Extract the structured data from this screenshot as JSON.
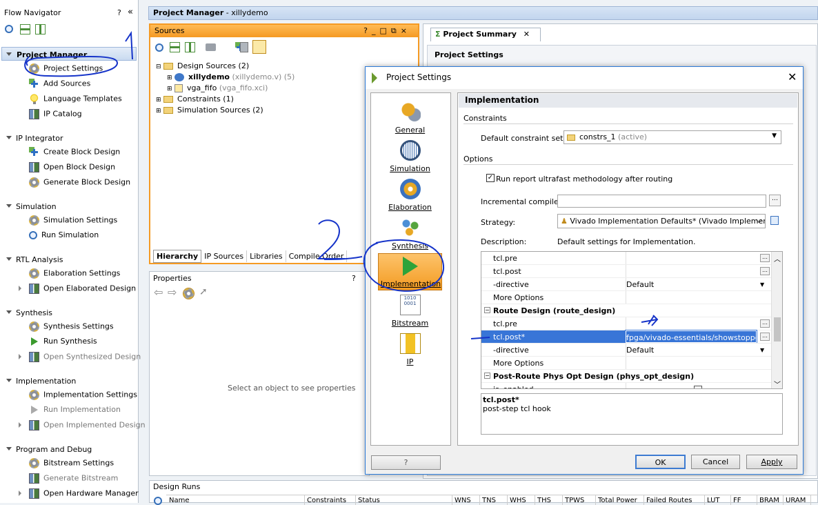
{
  "flow_navigator": {
    "title": "Flow Navigator",
    "help": "?",
    "collapse": "«",
    "sections": [
      {
        "label": "Project Manager",
        "items": [
          {
            "label": "Project Settings",
            "icon": "gear-icon"
          },
          {
            "label": "Add Sources",
            "icon": "add-sources-icon"
          },
          {
            "label": "Language Templates",
            "icon": "lightbulb-icon"
          },
          {
            "label": "IP Catalog",
            "icon": "ip-catalog-icon"
          }
        ]
      },
      {
        "label": "IP Integrator",
        "items": [
          {
            "label": "Create Block Design",
            "icon": "create-block-icon"
          },
          {
            "label": "Open Block Design",
            "icon": "open-block-icon"
          },
          {
            "label": "Generate Block Design",
            "icon": "generate-block-icon"
          }
        ]
      },
      {
        "label": "Simulation",
        "items": [
          {
            "label": "Simulation Settings",
            "icon": "gear-icon"
          },
          {
            "label": "Run Simulation",
            "icon": "run-simulation-icon"
          }
        ]
      },
      {
        "label": "RTL Analysis",
        "items": [
          {
            "label": "Elaboration Settings",
            "icon": "gear-icon"
          },
          {
            "label": "Open Elaborated Design",
            "icon": "open-design-icon"
          }
        ]
      },
      {
        "label": "Synthesis",
        "items": [
          {
            "label": "Synthesis Settings",
            "icon": "gear-icon"
          },
          {
            "label": "Run Synthesis",
            "icon": "run-synthesis-icon"
          },
          {
            "label": "Open Synthesized Design",
            "icon": "open-design-icon"
          }
        ]
      },
      {
        "label": "Implementation",
        "items": [
          {
            "label": "Implementation Settings",
            "icon": "gear-icon"
          },
          {
            "label": "Run Implementation",
            "icon": "run-implementation-icon"
          },
          {
            "label": "Open Implemented Design",
            "icon": "open-design-icon"
          }
        ]
      },
      {
        "label": "Program and Debug",
        "items": [
          {
            "label": "Bitstream Settings",
            "icon": "gear-icon"
          },
          {
            "label": "Generate Bitstream",
            "icon": "generate-bitstream-icon"
          },
          {
            "label": "Open Hardware Manager",
            "icon": "hardware-manager-icon"
          }
        ]
      }
    ]
  },
  "project_manager": {
    "title": "Project Manager",
    "project": "xillydemo"
  },
  "sources": {
    "title": "Sources",
    "controls": [
      "?",
      "_",
      "□",
      "⧉",
      "×"
    ],
    "tree": {
      "design_sources": "Design Sources (2)",
      "xillydemo": "xillydemo",
      "xillydemo_file": "(xillydemo.v) (5)",
      "vga_fifo": "vga_fifo",
      "vga_fifo_file": "(vga_fifo.xci)",
      "constraints": "Constraints (1)",
      "simulation_sources": "Simulation Sources (2)"
    },
    "tabs": [
      "Hierarchy",
      "IP Sources",
      "Libraries",
      "Compile Order"
    ]
  },
  "properties": {
    "title": "Properties",
    "help": "?",
    "empty_msg": "Select an object to see properties"
  },
  "design_runs": {
    "title": "Design Runs",
    "columns": [
      "Name",
      "Constraints",
      "Status",
      "WNS",
      "TNS",
      "WHS",
      "THS",
      "TPWS",
      "Total Power",
      "Failed Routes",
      "LUT",
      "FF",
      "BRAM",
      "URAM"
    ]
  },
  "project_summary": {
    "tab": "Project Summary",
    "heading": "Project Settings"
  },
  "dialog": {
    "title": "Project Settings",
    "categories": [
      "General",
      "Simulation",
      "Elaboration",
      "Synthesis",
      "Implementation",
      "Bitstream",
      "IP"
    ],
    "selected": "Implementation",
    "panel_title": "Implementation",
    "constraints_label": "Constraints",
    "default_constraint_label": "Default constraint set:",
    "default_constraint_value": "constrs_1",
    "default_constraint_active": "(active)",
    "options_label": "Options",
    "run_report_label": "Run report ultrafast methodology after routing",
    "run_report_checked": true,
    "incremental_label": "Incremental compile:",
    "incremental_value": "",
    "strategy_label": "Strategy:",
    "strategy_value": "Vivado Implementation Defaults* (Vivado Implement...",
    "description_label": "Description:",
    "description_value": "Default settings for Implementation.",
    "table_rows": [
      {
        "name": "tcl.pre",
        "value": "",
        "kind": "dots"
      },
      {
        "name": "tcl.post",
        "value": "",
        "kind": "dots"
      },
      {
        "name": "-directive",
        "value": "Default",
        "kind": "dropdown"
      },
      {
        "name": "More Options",
        "value": "",
        "kind": "text"
      },
      {
        "name": "Route Design (route_design)",
        "value": "",
        "kind": "header"
      },
      {
        "name": "tcl.pre",
        "value": "",
        "kind": "dots"
      },
      {
        "name": "tcl.post*",
        "value": "fpga/vivado-essentials/showstopper.tcl",
        "kind": "dots-selected"
      },
      {
        "name": "-directive",
        "value": "Default",
        "kind": "dropdown"
      },
      {
        "name": "More Options",
        "value": "",
        "kind": "text"
      },
      {
        "name": "Post-Route Phys Opt Design (phys_opt_design)",
        "value": "",
        "kind": "header"
      },
      {
        "name": "is_enabled",
        "value": "",
        "kind": "checkbox"
      }
    ],
    "help_title": "tcl.post*",
    "help_text": "post-step tcl hook",
    "help_button": "?",
    "ok": "OK",
    "cancel": "Cancel",
    "apply": "Apply"
  },
  "annotations": {
    "one": "1",
    "two": "2"
  },
  "colors": {
    "accent_orange": "#f59a23",
    "selection_blue": "#3875d7",
    "annotation_ink": "#1533c9"
  }
}
